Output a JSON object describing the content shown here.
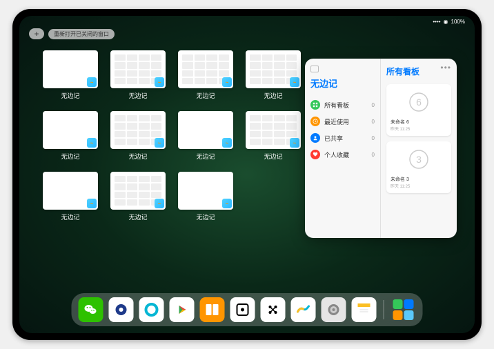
{
  "status": {
    "signal": "••••",
    "wifi": "◉",
    "battery": "100%"
  },
  "topbar": {
    "add": "+",
    "reopen": "重新打开已关闭的窗口"
  },
  "windows": {
    "label": "无边记",
    "count": 11
  },
  "popup": {
    "left_title": "无边记",
    "right_title": "所有看板",
    "more": "•••",
    "items": [
      {
        "icon": "grid",
        "color": "#34c759",
        "label": "所有看板",
        "count": "0"
      },
      {
        "icon": "clock",
        "color": "#ff9500",
        "label": "最近使用",
        "count": "0"
      },
      {
        "icon": "person",
        "color": "#007aff",
        "label": "已共享",
        "count": "0"
      },
      {
        "icon": "heart",
        "color": "#ff3b30",
        "label": "个人收藏",
        "count": "0"
      }
    ],
    "boards": [
      {
        "sketch": "6",
        "name": "未命名 6",
        "date": "昨天 11:25"
      },
      {
        "sketch": "3",
        "name": "未命名 3",
        "date": "昨天 11:25"
      }
    ]
  },
  "dock": [
    {
      "name": "wechat",
      "bg": "#2dc100",
      "glyph": "wechat"
    },
    {
      "name": "quark-hd",
      "bg": "#fff",
      "glyph": "quark-blue"
    },
    {
      "name": "quark",
      "bg": "#fff",
      "glyph": "quark-cyan"
    },
    {
      "name": "play",
      "bg": "#fff",
      "glyph": "play"
    },
    {
      "name": "books",
      "bg": "#ff9500",
      "glyph": "books"
    },
    {
      "name": "dice",
      "bg": "#fff",
      "glyph": "dice"
    },
    {
      "name": "app-x",
      "bg": "#fff",
      "glyph": "dots"
    },
    {
      "name": "freeform",
      "bg": "#fff",
      "glyph": "freeform"
    },
    {
      "name": "settings",
      "bg": "#e5e5e5",
      "glyph": "gear"
    },
    {
      "name": "notes",
      "bg": "#fff",
      "glyph": "notes"
    },
    {
      "name": "app-library",
      "bg": "",
      "glyph": "library"
    }
  ]
}
